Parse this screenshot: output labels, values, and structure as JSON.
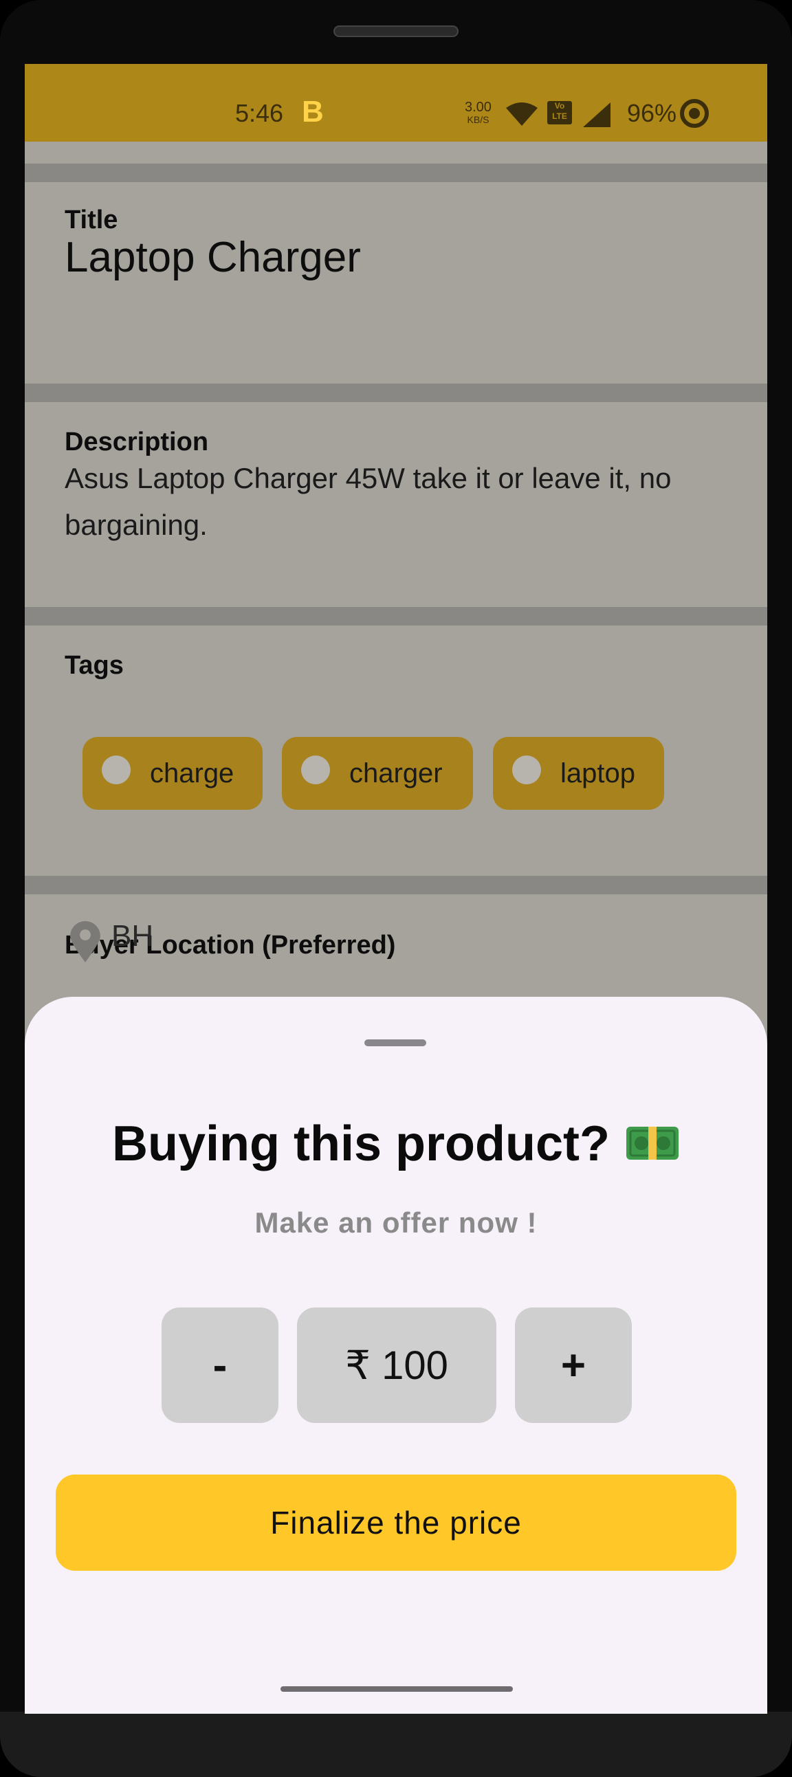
{
  "status_bar": {
    "time": "5:46",
    "app_badge": "B",
    "net_rate_value": "3.00",
    "net_rate_unit": "KB/S",
    "volte": "Vo LTE",
    "battery": "96%",
    "colors": {
      "background": "#ae8719",
      "badge": "#ffd24a"
    }
  },
  "product": {
    "title_label": "Title",
    "title_value": "Laptop Charger",
    "description_label": "Description",
    "description_value": "Asus Laptop Charger 45W take it or leave it, no bargaining.",
    "tags_label": "Tags",
    "tags": [
      {
        "label": "charge"
      },
      {
        "label": "charger"
      },
      {
        "label": "laptop"
      }
    ],
    "location_label": "Buyer Location (Preferred)",
    "location_value": "BH",
    "icons": [
      "location-pin-icon"
    ]
  },
  "offer_sheet": {
    "title": "Buying this product?",
    "title_icon": "money-bill-icon",
    "subtitle": "Make an offer now !",
    "decrement_label": "-",
    "price_value": "₹ 100",
    "increment_label": "+",
    "finalize_label": "Finalize the price",
    "colors": {
      "finalize": "#ffc727",
      "stepper": "#cfcfcf",
      "chip": "#a8831d"
    }
  }
}
